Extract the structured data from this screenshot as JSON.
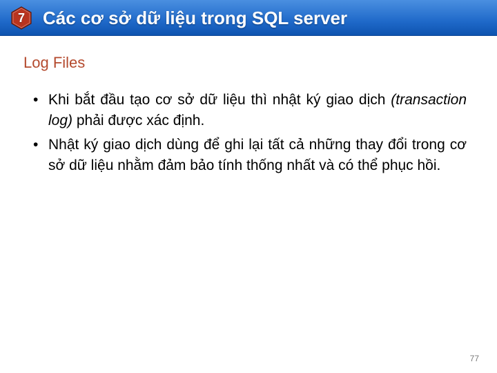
{
  "header": {
    "number": "7",
    "title": "Các cơ sở dữ liệu trong SQL server"
  },
  "subtitle": "Log Files",
  "bullets": [
    {
      "pre": "Khi bắt đầu tạo cơ sở dữ liệu thì nhật ký giao dịch ",
      "italic": "(transaction log)",
      "post": " phải được xác định."
    },
    {
      "pre": "Nhật ký giao dịch dùng để ghi lại tất cả những thay đổi trong cơ sở dữ liệu nhằm đảm bảo tính thống nhất và có thể phục hồi.",
      "italic": "",
      "post": ""
    }
  ],
  "pageNumber": "77"
}
